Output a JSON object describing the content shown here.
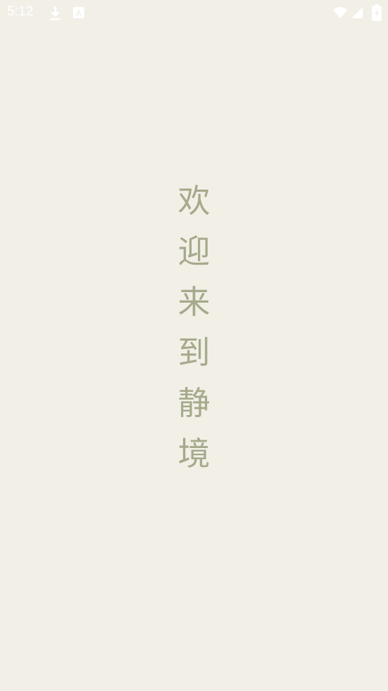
{
  "status_bar": {
    "time": "5:12",
    "icons": [
      "download-icon",
      "a-notification-icon",
      "wifi-icon",
      "cell-signal-icon",
      "battery-charging-icon"
    ],
    "icon_color": "#FFFFFF"
  },
  "welcome": {
    "chars": [
      "欢",
      "迎",
      "来",
      "到",
      "静",
      "境"
    ],
    "text_color": "#A6A98B"
  },
  "background_color": "#F2EFE7"
}
